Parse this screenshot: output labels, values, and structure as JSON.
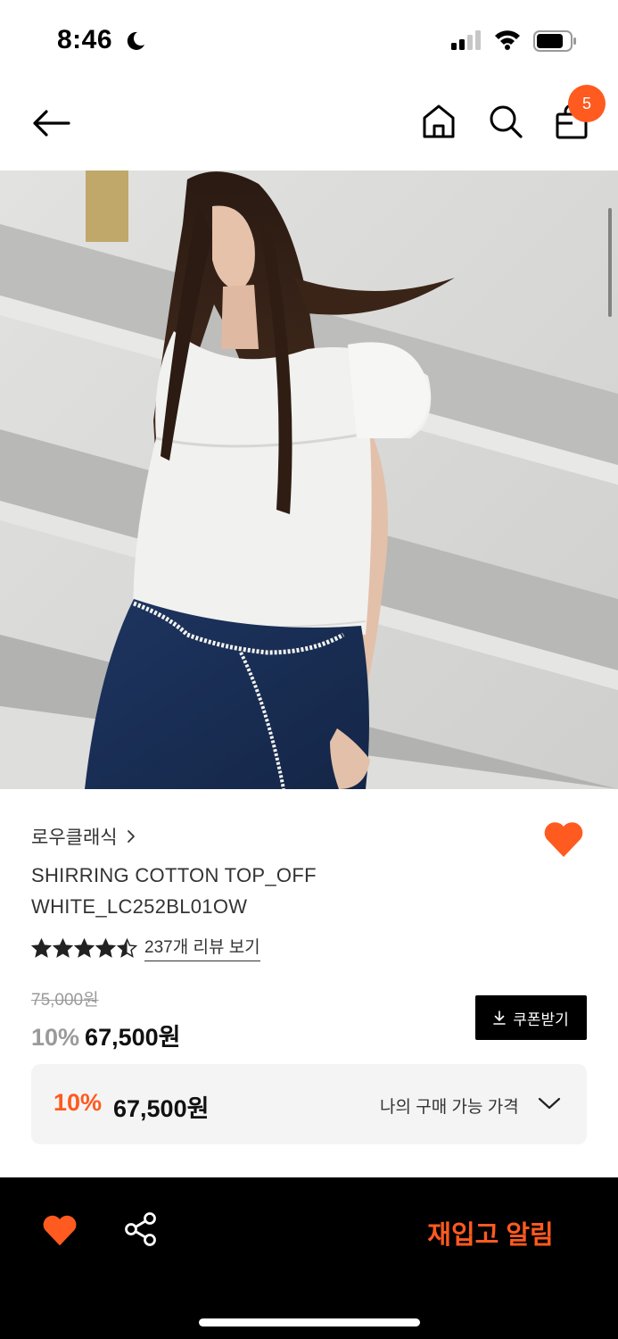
{
  "status_bar": {
    "time": "8:46"
  },
  "nav": {
    "cart_count": "5"
  },
  "product": {
    "brand": "로우클래식",
    "name": "SHIRRING COTTON TOP_OFF WHITE_LC252BL01OW",
    "rating": 4.5,
    "rating_max": 5,
    "review_link": "237개 리뷰 보기",
    "original_price": "75,000원",
    "discount_rate": "10%",
    "sale_price": "67,500원",
    "coupon_label": "쿠폰받기",
    "my_price": {
      "rate": "10%",
      "price": "67,500원",
      "label": "나의 구매 가능 가격"
    }
  },
  "bottom_bar": {
    "restock_label": "재입고 알림"
  },
  "colors": {
    "accent": "#ff5a1f",
    "dark": "#000000",
    "muted": "#9a9a9a",
    "price_box_bg": "#f4f4f4"
  },
  "icons": [
    "moon-icon",
    "signal-icon",
    "wifi-icon",
    "battery-icon",
    "back-arrow-icon",
    "home-icon",
    "search-icon",
    "shopping-bag-icon",
    "chevron-right-icon",
    "heart-icon",
    "star-icon",
    "download-icon",
    "chevron-down-icon",
    "share-icon"
  ]
}
